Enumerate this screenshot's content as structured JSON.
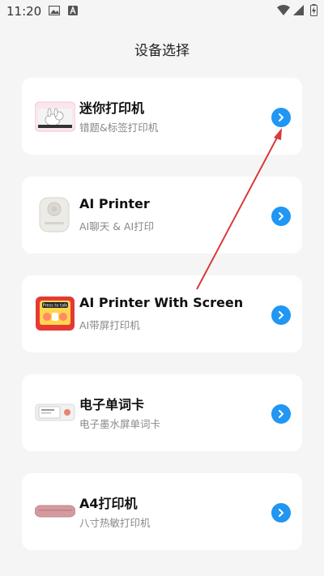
{
  "status_bar": {
    "time": "11:20",
    "icons": [
      "image-icon",
      "a-letter-icon",
      "wifi-icon",
      "signal-icon",
      "battery-charging-icon"
    ]
  },
  "page": {
    "title": "设备选择"
  },
  "devices": [
    {
      "title": "迷你打印机",
      "subtitle": "错题&标签打印机",
      "thumb": "mini-printer"
    },
    {
      "title": "AI Printer",
      "subtitle": "AI聊天 & AI打印",
      "thumb": "ai-printer"
    },
    {
      "title": "AI Printer With Screen",
      "subtitle": "AI带屏打印机",
      "thumb": "ai-printer-screen",
      "thumb_text": "Press to talk"
    },
    {
      "title": "电子单词卡",
      "subtitle": "电子墨水屏单词卡",
      "thumb": "word-card"
    },
    {
      "title": "A4打印机",
      "subtitle": "八寸热敏打印机",
      "thumb": "a4-printer"
    }
  ],
  "colors": {
    "accent": "#2196f3",
    "annotation_arrow": "#d93a3a",
    "background": "#f5f5f5"
  }
}
